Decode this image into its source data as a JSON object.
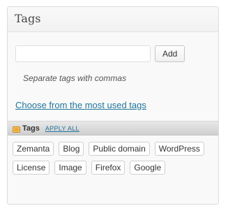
{
  "panel": {
    "title": "Tags"
  },
  "tag_input": {
    "value": "",
    "placeholder": ""
  },
  "add_label": "Add",
  "hint": "Separate tags with commas",
  "most_used_link": "Choose from the most used tags",
  "suggestions_bar": {
    "title": "Tags",
    "apply_all": "APPLY ALL",
    "icon": "tag-icon"
  },
  "suggested_tags": [
    "Zemanta",
    "Blog",
    "Public domain",
    "WordPress",
    "License",
    "Image",
    "Firefox",
    "Google"
  ],
  "colors": {
    "link": "#21759b",
    "icon_orange": "#e8a33a"
  }
}
